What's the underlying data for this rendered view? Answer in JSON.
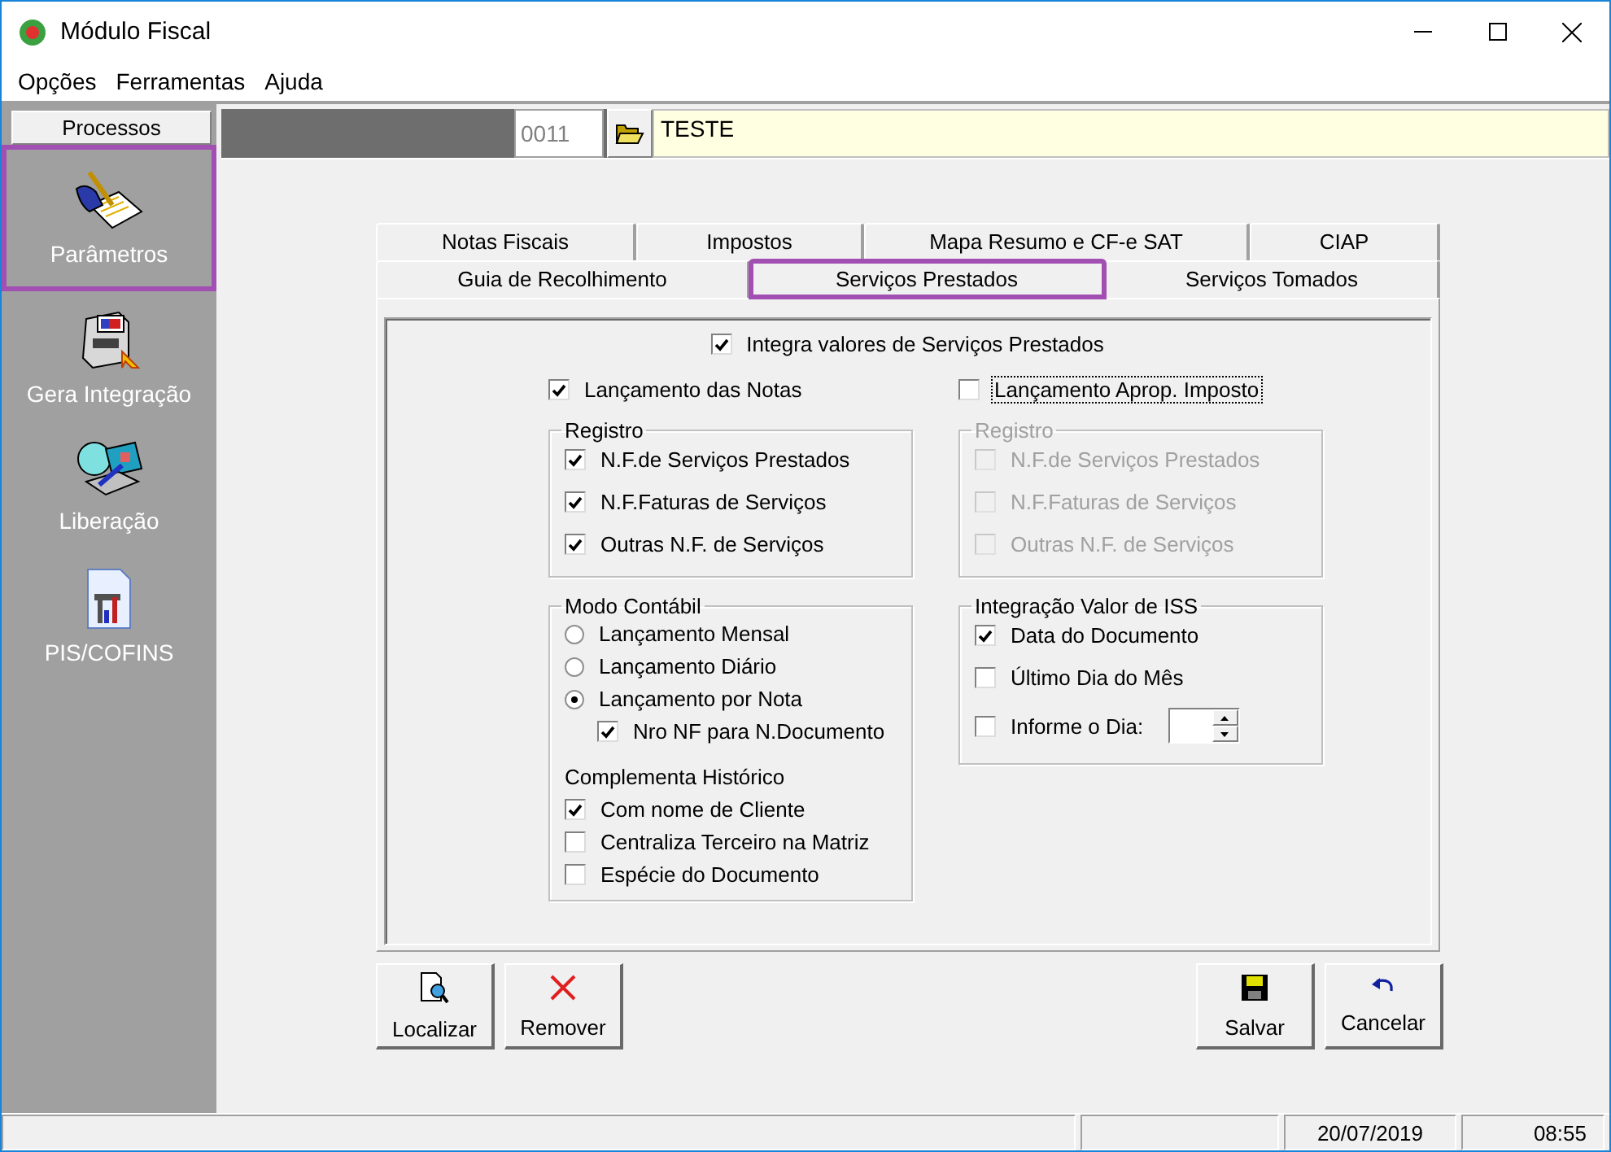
{
  "window": {
    "title": "Módulo Fiscal"
  },
  "menu": [
    "Opções",
    "Ferramentas",
    "Ajuda"
  ],
  "sidebar": {
    "header": "Processos",
    "items": [
      {
        "label": "Parâmetros",
        "selected": true
      },
      {
        "label": "Gera Integração",
        "selected": false
      },
      {
        "label": "Liberação",
        "selected": false
      },
      {
        "label": "PIS/COFINS",
        "selected": false
      }
    ]
  },
  "record": {
    "code": "0011",
    "name": "TESTE"
  },
  "tab_rows": [
    [
      {
        "label": "Notas Fiscais",
        "selected": false
      },
      {
        "label": "Impostos",
        "selected": false
      },
      {
        "label": "Mapa Resumo e CF-e SAT",
        "selected": false
      },
      {
        "label": "CIAP",
        "selected": false
      }
    ],
    [
      {
        "label": "Guia de Recolhimento",
        "selected": false
      },
      {
        "label": "Serviços Prestados",
        "selected": true
      },
      {
        "label": "Serviços Tomados",
        "selected": false
      }
    ]
  ],
  "panel": {
    "main": {
      "label": "Integra valores de Serviços Prestados",
      "checked": true
    },
    "columns": [
      {
        "toggle": {
          "label": "Lançamento das Notas",
          "checked": true,
          "focused": false
        },
        "groups": [
          {
            "title": "Registro",
            "disabled": false,
            "items": [
              {
                "kind": "checkbox",
                "label": "N.F.de Serviços Prestados",
                "checked": true
              },
              {
                "kind": "checkbox",
                "label": "N.F.Faturas de Serviços",
                "checked": true
              },
              {
                "kind": "checkbox",
                "label": "Outras N.F. de Serviços",
                "checked": true
              }
            ]
          },
          {
            "title": "Modo Contábil",
            "disabled": false,
            "items": [
              {
                "kind": "radio",
                "label": "Lançamento Mensal",
                "selected": false
              },
              {
                "kind": "radio",
                "label": "Lançamento Diário",
                "selected": false
              },
              {
                "kind": "radio",
                "label": "Lançamento por Nota",
                "selected": true,
                "children": [
                  {
                    "kind": "checkbox",
                    "label": "Nro NF para N.Documento",
                    "checked": true
                  }
                ]
              },
              {
                "kind": "heading",
                "label": "Complementa Histórico"
              },
              {
                "kind": "checkbox",
                "label": "Com nome de Cliente",
                "checked": true
              },
              {
                "kind": "checkbox",
                "label": "Centraliza Terceiro na Matriz",
                "checked": false
              },
              {
                "kind": "checkbox",
                "label": "Espécie do Documento",
                "checked": false
              }
            ]
          }
        ]
      },
      {
        "toggle": {
          "label": "Lançamento Aprop. Imposto",
          "checked": false,
          "focused": true
        },
        "groups": [
          {
            "title": "Registro",
            "disabled": true,
            "items": [
              {
                "kind": "checkbox",
                "label": "N.F.de Serviços Prestados",
                "checked": false
              },
              {
                "kind": "checkbox",
                "label": "N.F.Faturas de Serviços",
                "checked": false
              },
              {
                "kind": "checkbox",
                "label": "Outras N.F. de Serviços",
                "checked": false
              }
            ]
          },
          {
            "title": "Integração Valor de ISS",
            "disabled": false,
            "items": [
              {
                "kind": "checkbox",
                "label": "Data do Documento",
                "checked": true
              },
              {
                "kind": "checkbox",
                "label": "Último Dia do Mês",
                "checked": false
              },
              {
                "kind": "checkbox-spinner",
                "label": "Informe o Dia:",
                "checked": false
              }
            ]
          }
        ]
      }
    ]
  },
  "buttons_left": [
    {
      "kind": "find",
      "label": "Localizar"
    },
    {
      "kind": "remove",
      "label": "Remover"
    }
  ],
  "buttons_right": [
    {
      "kind": "save",
      "label": "Salvar"
    },
    {
      "kind": "cancel",
      "label": "Cancelar"
    }
  ],
  "status_bar": {
    "date": "20/07/2019",
    "time": "08:55"
  }
}
